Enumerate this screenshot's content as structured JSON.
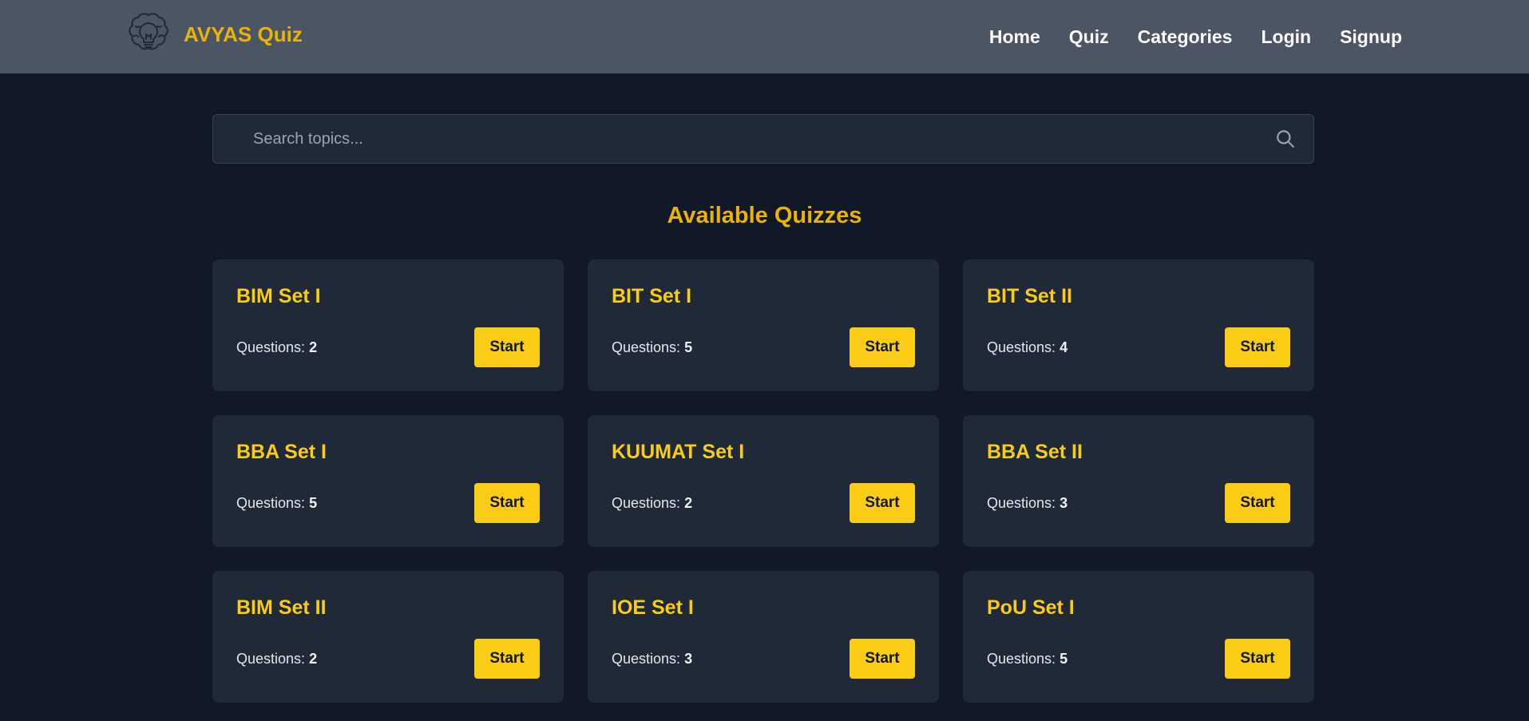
{
  "brand": {
    "name": "AVYAS Quiz",
    "logo_icon": "brain-lightbulb-icon"
  },
  "nav": {
    "links": [
      "Home",
      "Quiz",
      "Categories",
      "Login",
      "Signup"
    ]
  },
  "search": {
    "placeholder": "Search topics...",
    "value": "",
    "icon": "search-icon"
  },
  "main": {
    "title": "Available Quizzes",
    "question_label": "Questions:",
    "start_label": "Start",
    "quizzes": [
      {
        "title": "BIM Set I",
        "questions": "2"
      },
      {
        "title": "BIT Set I",
        "questions": "5"
      },
      {
        "title": "BIT Set II",
        "questions": "4"
      },
      {
        "title": "BBA Set I",
        "questions": "5"
      },
      {
        "title": "KUUMAT Set I",
        "questions": "2"
      },
      {
        "title": "BBA Set II",
        "questions": "3"
      },
      {
        "title": "BIM Set II",
        "questions": "2"
      },
      {
        "title": "IOE Set I",
        "questions": "3"
      },
      {
        "title": "PoU Set I",
        "questions": "5"
      }
    ]
  },
  "colors": {
    "background": "#111827",
    "navbar": "#4b5563",
    "card": "#1f2937",
    "accent": "#facc15",
    "brand": "#eab308"
  }
}
